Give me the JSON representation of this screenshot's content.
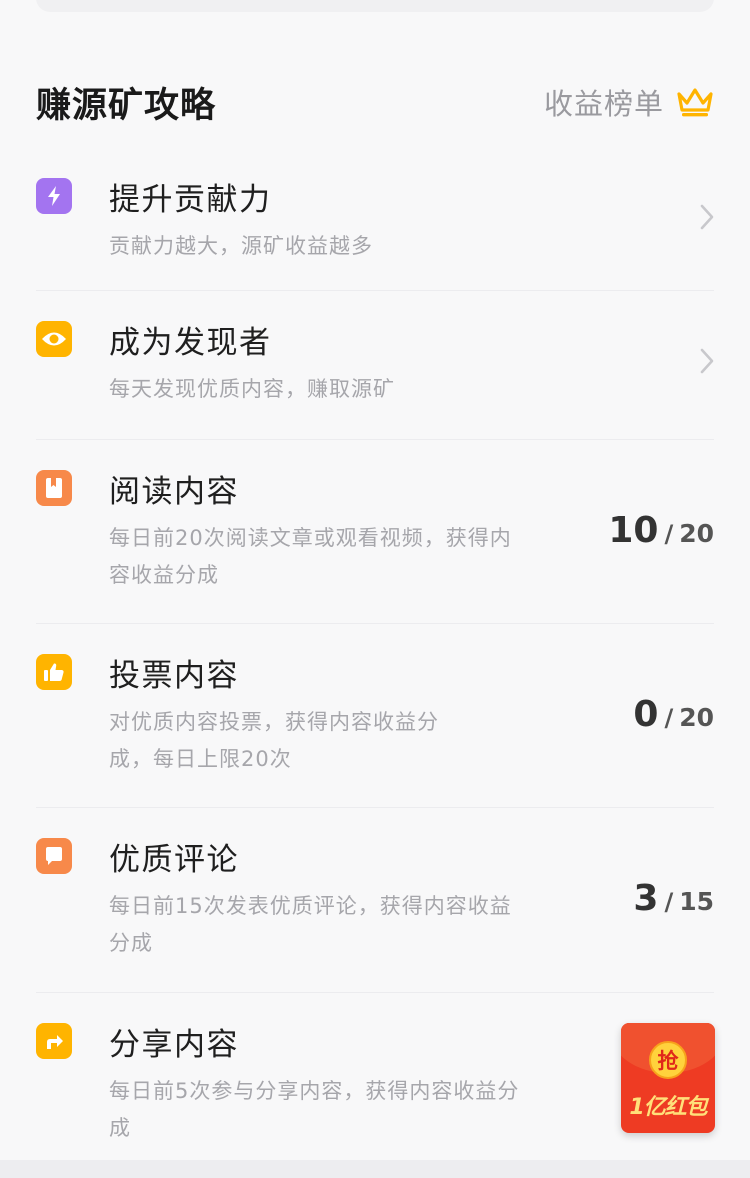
{
  "header": {
    "title": "赚源矿攻略",
    "rank_label": "收益榜单",
    "rank_icon": "crown-icon"
  },
  "colors": {
    "purple": "#a374f0",
    "yellow": "#ffb400",
    "orange": "#f7894a",
    "crown": "#ffb400"
  },
  "tasks": [
    {
      "title": "提升贡献力",
      "description": "贡献力越大，源矿收益越多",
      "icon": "lightning-icon",
      "action": "chevron"
    },
    {
      "title": "成为发现者",
      "description": "每天发现优质内容，赚取源矿",
      "icon": "eye-icon",
      "action": "chevron"
    },
    {
      "title": "阅读内容",
      "description": "每日前20次阅读文章或观看视频，获得内容收益分成",
      "icon": "book-icon",
      "done": "10",
      "sep": "/",
      "total": "20"
    },
    {
      "title": "投票内容",
      "description": "对优质内容投票，获得内容收益分成，每日上限20次",
      "icon": "thumbs-up-icon",
      "done": "0",
      "sep": "/",
      "total": "20"
    },
    {
      "title": "优质评论",
      "description": "每日前15次发表优质评论，获得内容收益分成",
      "icon": "comment-icon",
      "done": "3",
      "sep": "/",
      "total": "15"
    },
    {
      "title": "分享内容",
      "description": "每日前5次参与分享内容，获得内容收益分成",
      "icon": "share-icon"
    }
  ],
  "red_packet": {
    "badge": "抢",
    "label": "1亿红包"
  }
}
